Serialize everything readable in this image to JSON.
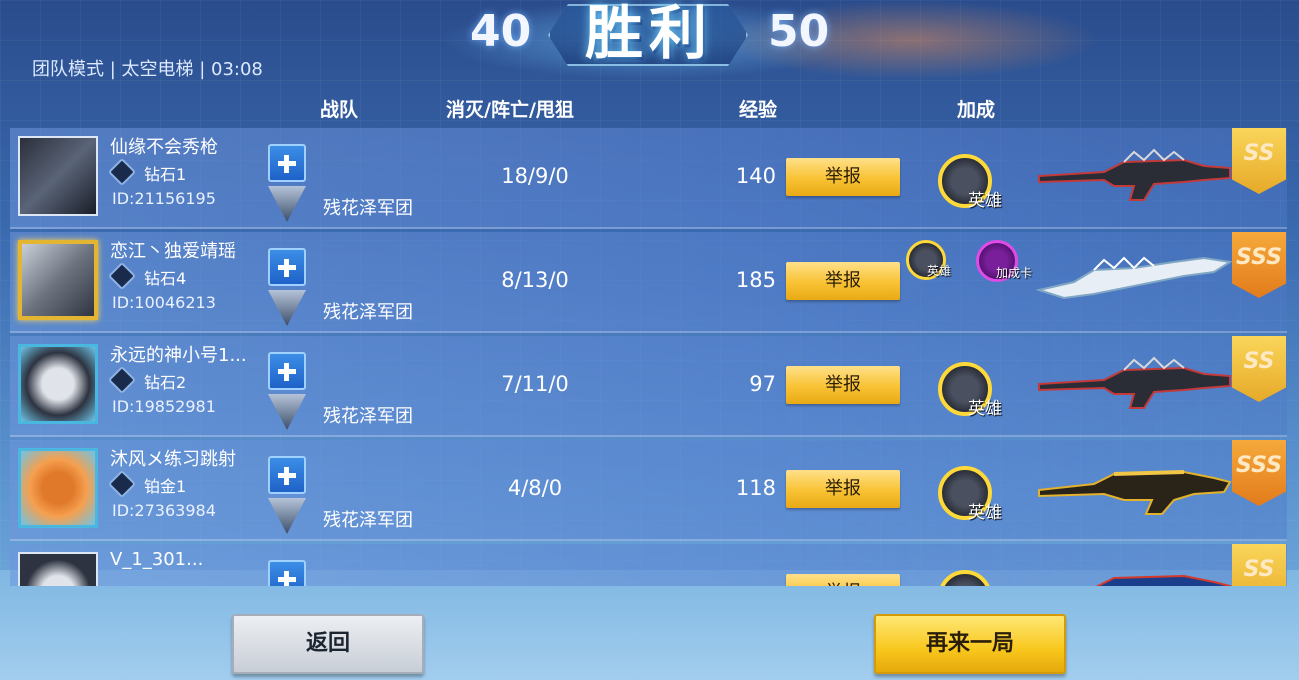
{
  "header": {
    "score_left": "40",
    "score_right": "50",
    "result": "胜利",
    "mode_info": "团队模式 | 太空电梯 | 03:08"
  },
  "columns": {
    "team": "战队",
    "kda": "消灭/阵亡/甩狙",
    "exp": "经验",
    "bonus": "加成"
  },
  "players": [
    {
      "name": "仙缘不会秀枪",
      "rank": "钻石1",
      "id": "ID:21156195",
      "team": "残花泽军团",
      "kda": "18/9/0",
      "exp": "140",
      "report": "举报",
      "bonuses": [
        "英雄"
      ],
      "weapon_rank": "SS"
    },
    {
      "name": "恋江丶独爱靖瑶",
      "rank": "钻石4",
      "id": "ID:10046213",
      "team": "残花泽军团",
      "kda": "8/13/0",
      "exp": "185",
      "report": "举报",
      "bonuses": [
        "英雄",
        "加成卡"
      ],
      "weapon_rank": "SSS"
    },
    {
      "name": "永远的神小号1...",
      "rank": "钻石2",
      "id": "ID:19852981",
      "team": "残花泽军团",
      "kda": "7/11/0",
      "exp": "97",
      "report": "举报",
      "bonuses": [
        "英雄"
      ],
      "weapon_rank": "SS"
    },
    {
      "name": "沐风メ练习跳射",
      "rank": "铂金1",
      "id": "ID:27363984",
      "team": "残花泽军团",
      "kda": "4/8/0",
      "exp": "118",
      "report": "举报",
      "bonuses": [
        "英雄"
      ],
      "weapon_rank": "SSS"
    },
    {
      "name": "V_1_301...",
      "rank": "",
      "id": "",
      "team": "",
      "kda": "",
      "exp": "",
      "report": "举报",
      "bonuses": [],
      "weapon_rank": "SS"
    }
  ],
  "buttons": {
    "back": "返回",
    "again": "再来一局"
  },
  "colors": {
    "report_button": "#f8c233",
    "again_button": "#f8c71c",
    "back_button": "#c8ced6",
    "rank_badge": "#e27b1c"
  }
}
